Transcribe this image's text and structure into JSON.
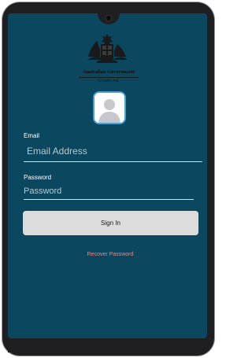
{
  "header": {
    "org_line1": "Australian Government",
    "org_line2": "COMCAR"
  },
  "form": {
    "email_label": "Email",
    "email_placeholder": "Email Address",
    "email_value": "",
    "password_label": "Password",
    "password_placeholder": "Password",
    "password_value": "",
    "signin_label": "Sign In",
    "recover_label": "Recover Password"
  },
  "icons": {
    "crest": "coat-of-arms-icon",
    "avatar": "user-avatar-icon",
    "camera": "front-camera-icon"
  },
  "colors": {
    "screen_background": "#0b475f",
    "button_background": "#dcdcdc",
    "recover_link": "#e08a8a",
    "avatar_border": "#4aa0d4"
  }
}
